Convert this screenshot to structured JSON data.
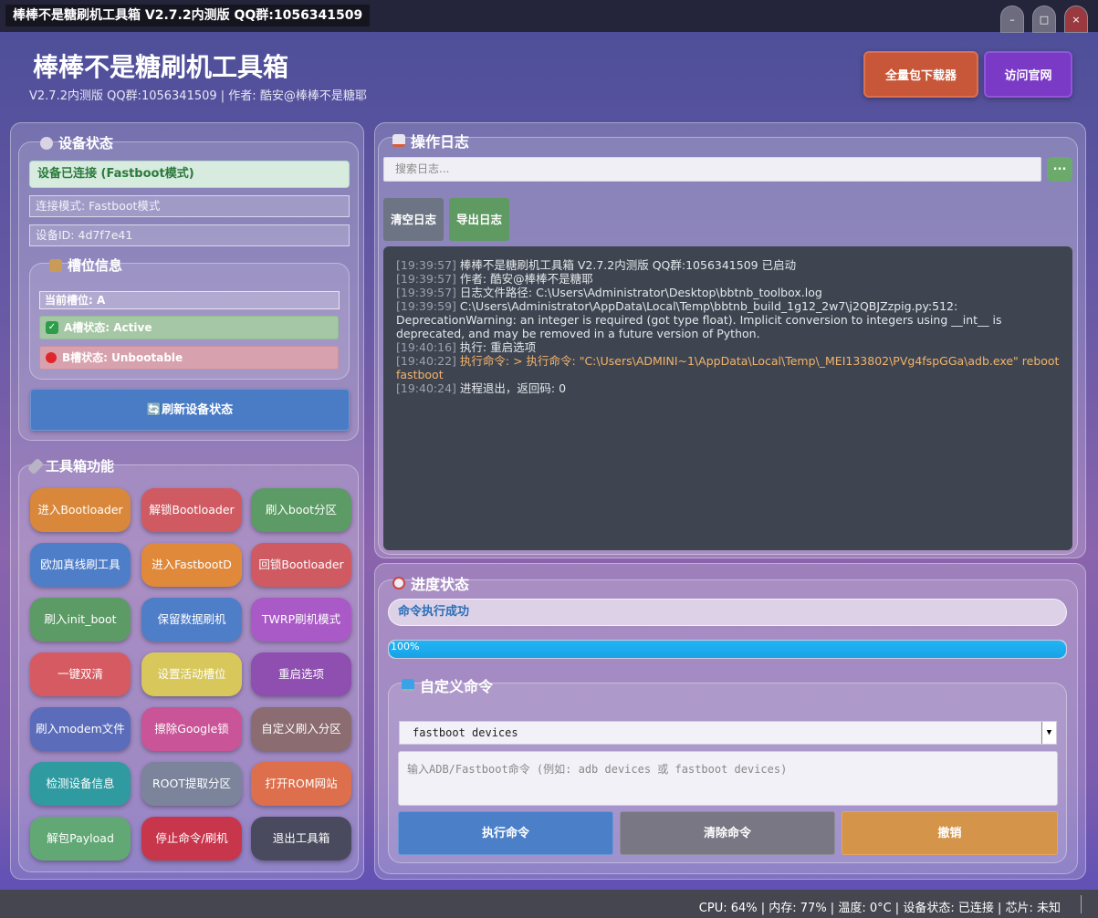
{
  "window": {
    "title": "棒棒不是糖刷机工具箱 V2.7.2内测版  QQ群:1056341509",
    "min_label": "–",
    "max_label": "□",
    "close_label": "×"
  },
  "header": {
    "title": "棒棒不是糖刷机工具箱",
    "subtitle": "V2.7.2内测版  QQ群:1056341509 | 作者: 酷安@棒棒不是糖耶",
    "download_button": "全量包下载器",
    "website_button": "访问官网"
  },
  "device": {
    "group_title": "设备状态",
    "status": "设备已连接 (Fastboot模式)",
    "mode": "连接模式: Fastboot模式",
    "device_id": "设备ID: 4d7f7e41",
    "slot_title": "槽位信息",
    "current_slot": "当前槽位: A",
    "slot_a": "A槽状态: Active",
    "slot_b": "B槽状态: Unbootable",
    "refresh_button": "🔄刷新设备状态"
  },
  "tools": {
    "group_title": "工具箱功能",
    "buttons": [
      {
        "label": "进入Bootloader",
        "color": "#d9873a"
      },
      {
        "label": "解锁Bootloader",
        "color": "#cf5a62"
      },
      {
        "label": "刷入boot分区",
        "color": "#5d9b66"
      },
      {
        "label": "欧加真线刷工具",
        "color": "#4f7ec8"
      },
      {
        "label": "进入FastbootD",
        "color": "#e0893a"
      },
      {
        "label": "回锁Bootloader",
        "color": "#cf5a62"
      },
      {
        "label": "刷入init_boot",
        "color": "#5d9b66"
      },
      {
        "label": "保留数据刷机",
        "color": "#4f7ec8"
      },
      {
        "label": "TWRP刷机模式",
        "color": "#a95ac6"
      },
      {
        "label": "一键双清",
        "color": "#d65a61"
      },
      {
        "label": "设置活动槽位",
        "color": "#d8c75a"
      },
      {
        "label": "重启选项",
        "color": "#8e4fb0"
      },
      {
        "label": "刷入modem文件",
        "color": "#5a6cba"
      },
      {
        "label": "擦除Google锁",
        "color": "#c95497"
      },
      {
        "label": "自定义刷入分区",
        "color": "#8b6c70"
      },
      {
        "label": "检测设备信息",
        "color": "#2f9aa0"
      },
      {
        "label": "ROOT提取分区",
        "color": "#7c849c"
      },
      {
        "label": "打开ROM网站",
        "color": "#de6f4c"
      },
      {
        "label": "解包Payload",
        "color": "#61a874"
      },
      {
        "label": "停止命令/刷机",
        "color": "#c8364b"
      },
      {
        "label": "退出工具箱",
        "color": "#4a4a5e"
      }
    ]
  },
  "log": {
    "group_title": "操作日志",
    "search_placeholder": "搜索日志...",
    "search_button": "...",
    "clear_button": "清空日志",
    "export_button": "导出日志",
    "lines": [
      {
        "ts": "[19:39:57]",
        "msg": "棒棒不是糖刷机工具箱 V2.7.2内测版 QQ群:1056341509 已启动",
        "warn": false
      },
      {
        "ts": "[19:39:57]",
        "msg": "作者: 酷安@棒棒不是糖耶",
        "warn": false
      },
      {
        "ts": "[19:39:57]",
        "msg": "日志文件路径: C:\\Users\\Administrator\\Desktop\\bbtnb_toolbox.log",
        "warn": false
      },
      {
        "ts": "[19:39:59]",
        "msg": "C:\\Users\\Administrator\\AppData\\Local\\Temp\\bbtnb_build_1g12_2w7\\j2QBJZzpig.py:512: DeprecationWarning: an integer is required (got type float). Implicit conversion to integers using __int__ is deprecated, and may be removed in a future version of Python.",
        "warn": false
      },
      {
        "ts": "[19:40:16]",
        "msg": "执行: 重启选项",
        "warn": false
      },
      {
        "ts": "[19:40:22]",
        "msg": "执行命令: > 执行命令: \"C:\\Users\\ADMINI~1\\AppData\\Local\\Temp\\_MEI133802\\PVg4fspGGa\\adb.exe\" reboot fastboot",
        "warn": true
      },
      {
        "ts": "[19:40:24]",
        "msg": "进程退出，返回码: 0",
        "warn": false
      }
    ]
  },
  "progress": {
    "group_title": "进度状态",
    "status": "命令执行成功",
    "percent": 100,
    "percent_label": "100%"
  },
  "custom_cmd": {
    "group_title": "自定义命令",
    "selected": "fastboot devices",
    "placeholder": "输入ADB/Fastboot命令 (例如: adb devices 或 fastboot devices)",
    "execute_button": "执行命令",
    "clear_button": "清除命令",
    "undo_button": "撤销"
  },
  "statusbar": {
    "text": "CPU: 64% | 内存: 77% | 温度: 0°C | 设备状态: 已连接 | 芯片: 未知"
  },
  "colors": {
    "accent_blue": "#4a7cc6",
    "ok_green": "#2b7a3c",
    "progress": "#17a3e6"
  }
}
